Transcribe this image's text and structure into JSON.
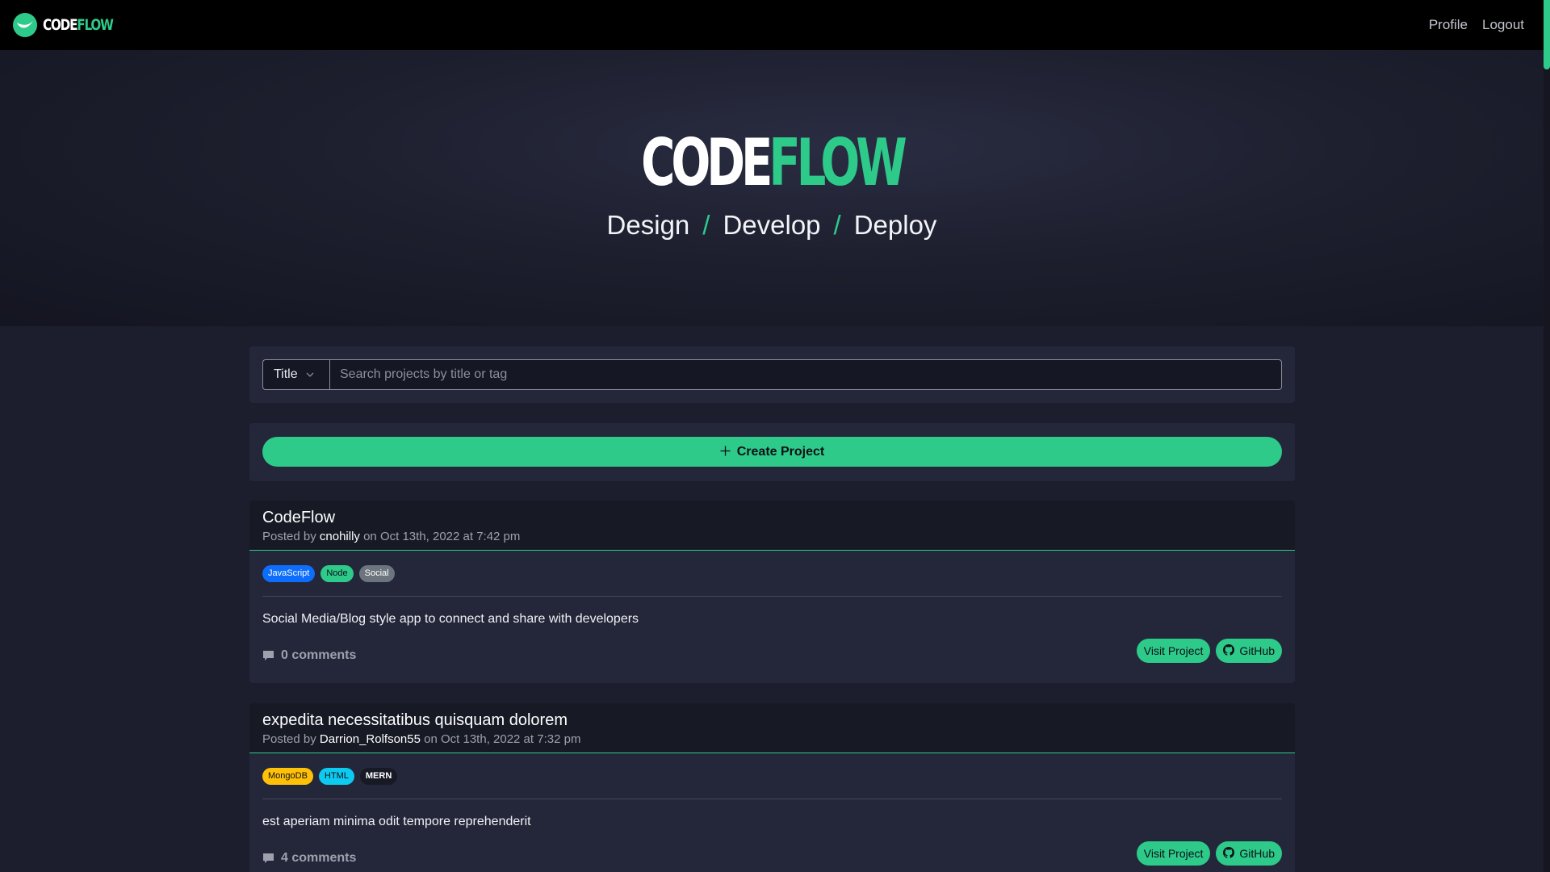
{
  "colors": {
    "accent": "#2dca8a",
    "navbar": "#000000",
    "page_bg": "#1c1e2e",
    "panel_bg": "#24273a",
    "tag_javascript": "#0d6efd",
    "tag_node": "#2dca8a",
    "tag_social": "#6c757d",
    "tag_mongodb": "#ffc107",
    "tag_html": "#0dcaf0",
    "tag_mern": "#171925"
  },
  "navbar": {
    "brand_code": "CODE",
    "brand_flow": "FLOW",
    "brand_icon": "wave-logo-icon",
    "links": [
      "Profile",
      "Logout"
    ]
  },
  "hero": {
    "title_code": "CODE",
    "title_flow": "FLOW",
    "tagline": [
      "Design",
      "Develop",
      "Deploy"
    ],
    "separator": "/"
  },
  "search": {
    "select_value": "Title",
    "select_icon": "chevron-down-icon",
    "placeholder": "Search projects by title or tag"
  },
  "create": {
    "label": "Create Project",
    "icon": "plus-icon"
  },
  "projects": [
    {
      "title": "CodeFlow",
      "posted_by": "Posted by",
      "author": "cnohilly",
      "date": "on Oct 13th, 2022 at 7:42 pm",
      "tags": [
        {
          "label": "JavaScript",
          "color": "#0d6efd",
          "text_color": "#ffffff"
        },
        {
          "label": "Node",
          "color": "#2dca8a",
          "text_color": "#0d0f16"
        },
        {
          "label": "Social",
          "color": "#6c757d",
          "text_color": "#ffffff"
        }
      ],
      "description": "Social Media/Blog style app to connect and share with developers",
      "comments": "0 comments",
      "visit_label": "Visit Project",
      "github_label": "GitHub"
    },
    {
      "title": "expedita necessitatibus quisquam dolorem",
      "posted_by": "Posted by",
      "author": "Darrion_Rolfson55",
      "date": "on Oct 13th, 2022 at 7:32 pm",
      "tags": [
        {
          "label": "MongoDB",
          "color": "#ffc107",
          "text_color": "#0d0f16"
        },
        {
          "label": "HTML",
          "color": "#0dcaf0",
          "text_color": "#0d0f16"
        },
        {
          "label": "MERN",
          "color": "#171925",
          "text_color": "#ffffff"
        }
      ],
      "description": "est aperiam minima odit tempore reprehenderit",
      "comments": "4 comments",
      "visit_label": "Visit Project",
      "github_label": "GitHub"
    }
  ]
}
